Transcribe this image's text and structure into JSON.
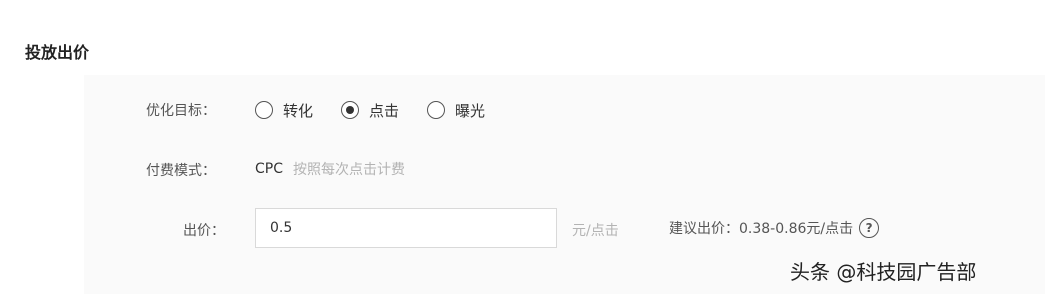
{
  "section": {
    "title": "投放出价"
  },
  "goal": {
    "label": "优化目标：",
    "options": [
      {
        "label": "转化",
        "selected": false
      },
      {
        "label": "点击",
        "selected": true
      },
      {
        "label": "曝光",
        "selected": false
      }
    ]
  },
  "billing": {
    "label": "付费模式：",
    "value": "CPC",
    "hint": "按照每次点击计费"
  },
  "bid": {
    "label": "出价：",
    "value": "0.5",
    "unit": "元/点击",
    "suggestion": "建议出价：0.38-0.86元/点击",
    "help_icon_glyph": "?"
  },
  "watermark": {
    "text": "头条 @科技园广告部"
  }
}
